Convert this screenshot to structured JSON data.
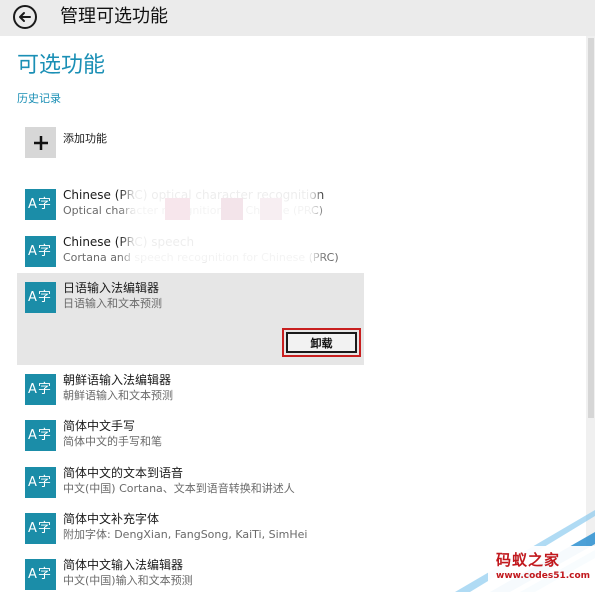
{
  "window": {
    "title": "管理可选功能"
  },
  "page": {
    "heading": "可选功能",
    "history_link": "历史记录",
    "add_feature_label": "添加功能"
  },
  "features": [
    {
      "name": "Chinese (PRC) optical character recognition",
      "description": "Optical character recognition for Chinese (PRC)",
      "icon": "language-icon"
    },
    {
      "name": "Chinese (PRC) speech",
      "description": "Cortana and speech recognition for Chinese (PRC)",
      "icon": "language-icon"
    },
    {
      "name": "日语输入法编辑器",
      "description": "日语输入和文本预测",
      "icon": "language-icon",
      "selected": true,
      "action_label": "卸载"
    },
    {
      "name": "朝鲜语输入法编辑器",
      "description": "朝鲜语输入和文本预测",
      "icon": "language-icon"
    },
    {
      "name": "简体中文手写",
      "description": "简体中文的手写和笔",
      "icon": "language-icon"
    },
    {
      "name": "简体中文的文本到语音",
      "description": "中文(中国) Cortana、文本到语音转换和讲述人",
      "icon": "language-icon"
    },
    {
      "name": "简体中文补充字体",
      "description": "附加字体: DengXian, FangSong, KaiTi, SimHei",
      "icon": "language-icon"
    },
    {
      "name": "简体中文输入法编辑器",
      "description": "中文(中国)输入和文本预测",
      "icon": "language-icon"
    }
  ],
  "icon_glyph": {
    "letter": "A",
    "char": "字"
  },
  "watermark": {
    "title": "码蚁之家",
    "url": "www.codes51.com"
  },
  "colors": {
    "accent": "#1a8fb5",
    "tile": "#1b8da8",
    "highlight_border": "#c81f1f",
    "watermark": "#c1181d"
  }
}
